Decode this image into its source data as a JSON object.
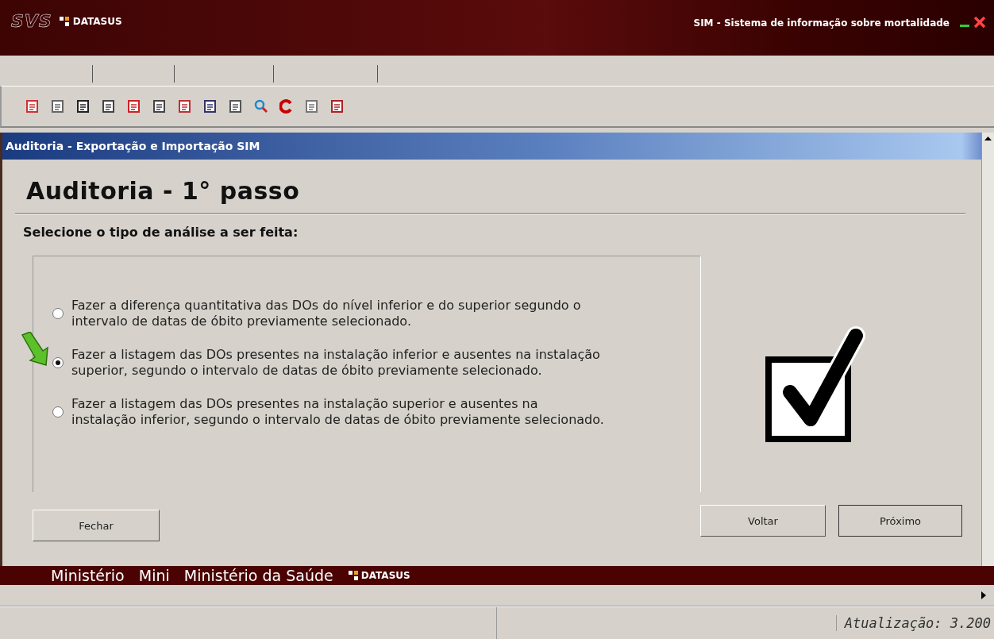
{
  "header": {
    "logo": "SVS",
    "brand": "DATASUS",
    "title": "SIM - Sistema de informação sobre mortalidade"
  },
  "dialog": {
    "title": "Auditoria - Exportação e Importação SIM",
    "heading": "Auditoria - 1° passo",
    "prompt": "Selecione o tipo de análise a ser feita:",
    "options": [
      {
        "label": "Fazer a diferença quantitativa das DOs do nível inferior e do superior segundo o intervalo de datas de óbito previamente selecionado.",
        "selected": false
      },
      {
        "label": "Fazer a listagem das DOs presentes na instalação inferior e ausentes na instalação superior, segundo o intervalo de datas de óbito previamente selecionado.",
        "selected": true
      },
      {
        "label": "Fazer a listagem das DOs presentes na instalação superior e ausentes na instalação inferior, segundo o intervalo de datas de óbito previamente selecionado.",
        "selected": false
      }
    ],
    "buttons": {
      "close": "Fechar",
      "back": "Voltar",
      "next": "Próximo"
    }
  },
  "footer": {
    "texts": [
      "Ministério",
      "Mini",
      "Ministério da Saúde"
    ],
    "brand": "DATASUS"
  },
  "status_bar": {
    "version": "Atualização: 3.200"
  }
}
